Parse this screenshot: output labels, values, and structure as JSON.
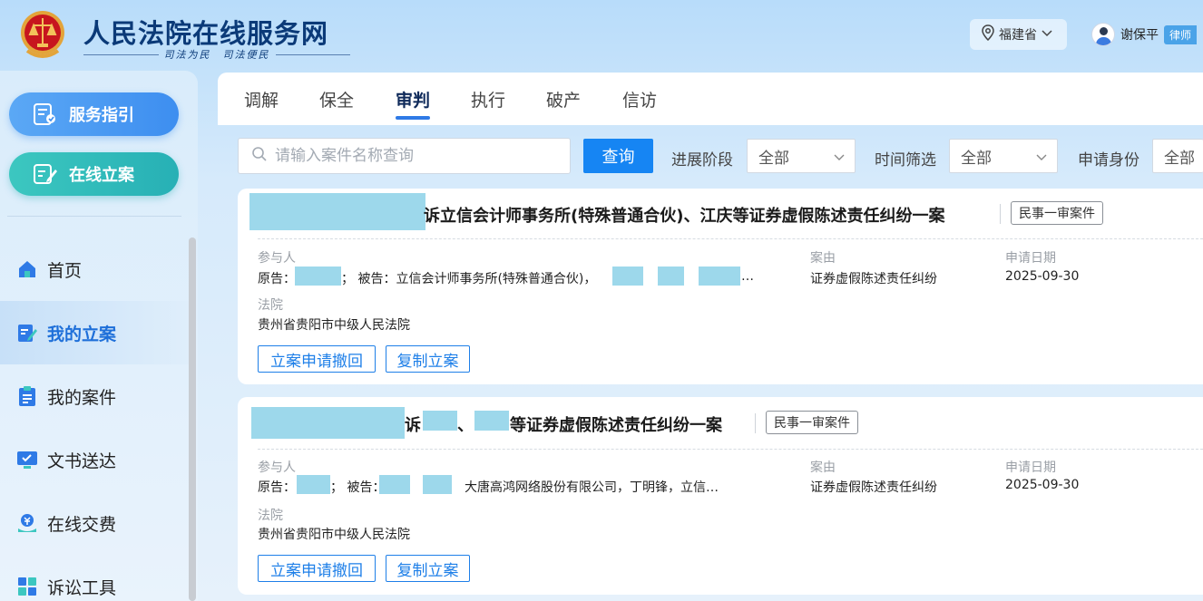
{
  "header": {
    "site_title": "人民法院在线服务网",
    "slogan": "司法为民　司法便民",
    "region": "福建省",
    "user_name": "谢保平",
    "user_role": "律师"
  },
  "sidebar": {
    "primary_buttons": [
      {
        "label": "服务指引",
        "icon": "guide-icon"
      },
      {
        "label": "在线立案",
        "icon": "file-edit-icon"
      }
    ],
    "items": [
      {
        "label": "首页",
        "icon": "home-icon",
        "active": false
      },
      {
        "label": "我的立案",
        "icon": "edit-icon",
        "active": true
      },
      {
        "label": "我的案件",
        "icon": "clipboard-icon",
        "active": false
      },
      {
        "label": "文书送达",
        "icon": "monitor-icon",
        "active": false
      },
      {
        "label": "在线交费",
        "icon": "payment-icon",
        "active": false
      },
      {
        "label": "诉讼工具",
        "icon": "tools-icon",
        "active": false
      }
    ]
  },
  "tabs": [
    {
      "label": "调解"
    },
    {
      "label": "保全"
    },
    {
      "label": "审判",
      "active": true
    },
    {
      "label": "执行"
    },
    {
      "label": "破产"
    },
    {
      "label": "信访"
    }
  ],
  "filters": {
    "search_placeholder": "请输入案件名称查询",
    "search_button": "查询",
    "stage_label": "进展阶段",
    "stage_value": "全部",
    "time_label": "时间筛选",
    "time_value": "全部",
    "identity_label": "申请身份",
    "identity_value": "全部"
  },
  "cases": [
    {
      "title_suffix": "诉立信会计师事务所(特殊普通合伙)、江庆等证券虚假陈述责任纠纷一案",
      "tag": "民事一审案件",
      "participants_label": "参与人",
      "participants_plaintiff": "原告：",
      "participants_defendant": "；  被告：立信会计师事务所(特殊普通合伙)，",
      "participants_more": "…",
      "cause_label": "案由",
      "cause": "证券虚假陈述责任纠纷",
      "date_label": "申请日期",
      "date": "2025-09-30",
      "court_label": "法院",
      "court": "贵州省贵阳市中级人民法院",
      "btn_withdraw": "立案申请撤回",
      "btn_copy": "复制立案"
    },
    {
      "title_part1": "诉",
      "title_part2": "、",
      "title_part3": "等证券虚假陈述责任纠纷一案",
      "tag": "民事一审案件",
      "participants_label": "参与人",
      "participants_plaintiff": "原告：",
      "participants_defendant": "；  被告：",
      "participants_rest": "大唐高鸿网络股份有限公司，丁明锋，立信…",
      "cause_label": "案由",
      "cause": "证券虚假陈述责任纠纷",
      "date_label": "申请日期",
      "date": "2025-09-30",
      "court_label": "法院",
      "court": "贵州省贵阳市中级人民法院",
      "btn_withdraw": "立案申请撤回",
      "btn_copy": "复制立案"
    }
  ],
  "colors": {
    "primary": "#1685f3",
    "active_nav": "#1e6fd9",
    "title_navy": "#0b3a78",
    "redaction": "#9dd8eb"
  }
}
